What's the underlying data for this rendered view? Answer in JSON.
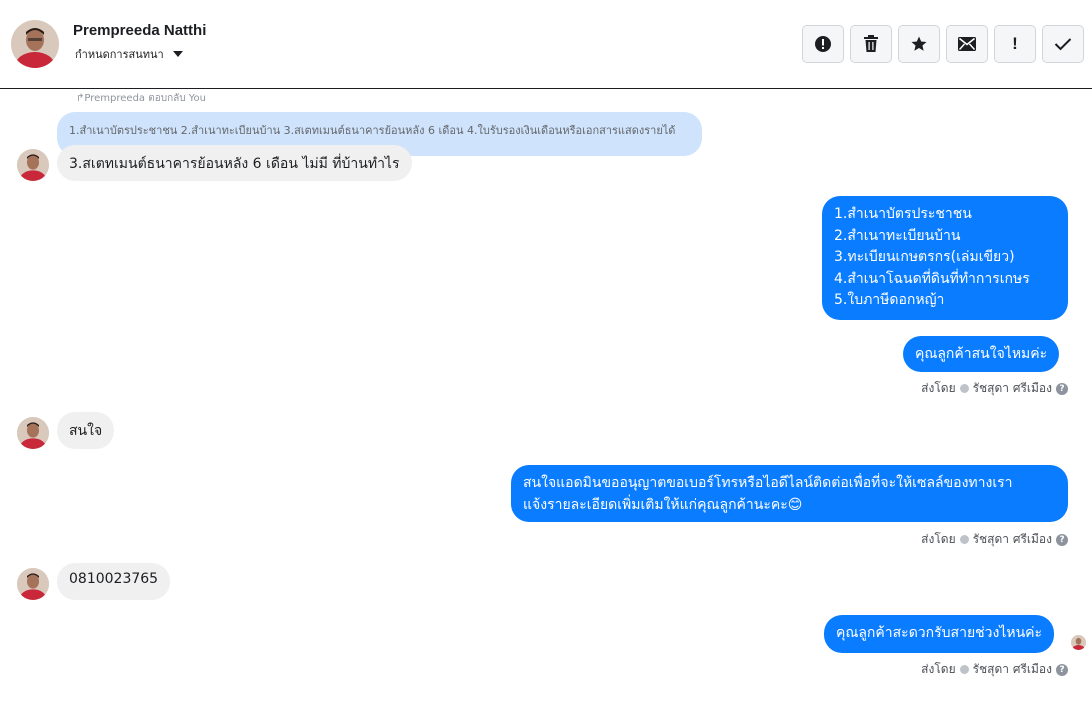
{
  "header": {
    "contact_name": "Prempreeda Natthi",
    "assign_label": "กำหนดการสนทนา",
    "toolbar": [
      {
        "name": "alert-icon",
        "label": "!"
      },
      {
        "name": "trash-icon",
        "label": ""
      },
      {
        "name": "star-icon",
        "label": ""
      },
      {
        "name": "envelope-icon",
        "label": ""
      },
      {
        "name": "exclamation-icon",
        "label": "!"
      },
      {
        "name": "check-icon",
        "label": ""
      }
    ]
  },
  "messages": {
    "reply_note": "↱Prempreeda ตอบกลับ You",
    "quoted_text": "1.สำเนาบัตรประชาชน 2.สำเนาทะเบียนบ้าน 3.สเตทเมนต์ธนาคารย้อนหลัง 6 เดือน 4.ใบรับรองเงินเดือนหรือเอกสารแสดงรายได้",
    "m1": "3.สเตทเมนต์ธนาคารย้อนหลัง 6 เดือน   ไม่มี  ที่บ้านทำไร",
    "m2_lines": [
      "1.สำเนาบัตรประชาชน",
      "2.สำเนาทะเบียนบ้าน",
      "3.ทะเบียนเกษตรกร(เล่มเขียว)",
      "4.สำเนาโฉนดที่ดินที่ทำการเกษร",
      "5.ใบภาษีดอกหญ้า"
    ],
    "m3": "คุณลูกค้าสนใจไหมค่ะ",
    "m4": "สนใจ",
    "m5_lines": [
      "สนใจแอดมินขออนุญาตขอเบอร์โทรหรือไอดีไลน์ติดต่อเพื่อที่จะให้เซลล์ของทางเรา",
      "แจ้งรายละเอียดเพิ่มเติมให้แก่คุณลูกค้านะคะ😊"
    ],
    "m6": "0810023765",
    "m7": "คุณลูกค้าสะดวกรับสายช่วงไหนค่ะ",
    "sent_by_prefix": "ส่งโดย",
    "sent_by_name": "รัชสุดา ศรีเมือง",
    "help_mark": "?"
  },
  "colors": {
    "outgoing": "#0a7cff",
    "incoming": "#f0f0f0",
    "quoted": "#cfe3fc"
  }
}
